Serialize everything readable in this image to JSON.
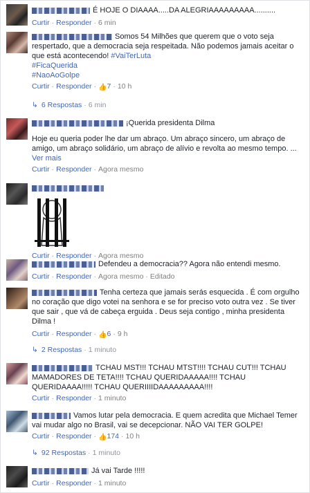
{
  "actions": {
    "curtir": "Curtir",
    "responder": "Responder",
    "edited": "Editado",
    "ver_mais": "Ver mais"
  },
  "comments": [
    {
      "text": "É HOJE O DIAAAA.....DA ALEGRIAAAAAAAAA..........",
      "time": "6 min"
    },
    {
      "text": "Somos 54 Milhões que querem que o voto seja respertado, que a democracia seja respeitada. Não podemos jamais aceitar o que está acontecendo!",
      "hashtag1": "#VaiTerLuta",
      "hashtag2": "#FicaQuerida",
      "hashtag3": "#NaoAoGolpe",
      "likes": "7",
      "time": "10 h",
      "replies": "6 Respostas",
      "replies_time": "6 min"
    },
    {
      "text_head": "¡Querida presidenta Dilma",
      "text": "Hoje eu queria poder lhe dar um abraço. Um abraço sincero, um abraço de amigo, um abraço solidário, um abraço de alívio e revolta ao mesmo tempo. ...",
      "time": "Agora mesmo"
    },
    {
      "time": "Agora mesmo"
    },
    {
      "text": "Defendeu a democracia?? Agora não entendi mesmo.",
      "time": "Agora mesmo"
    },
    {
      "text": "Tenha certeza que jamais serás esquecida . É com orgulho no coração que digo votei na senhora e se for preciso voto outra vez . Se tiver que sair , que vá de cabeça erguida . Deus seja contigo , minha presidenta Dilma !",
      "likes": "6",
      "time": "9 h",
      "replies": "2 Respostas",
      "replies_time": "1 minuto"
    },
    {
      "text": "TCHAU MST!!! TCHAU MTST!!!! TCHAU CUT!!! TCHAU MAMADORES DE TETA!!!! TCHAU QUERIDAAAAA!!!! TCHAU QUERIDAAAA!!!!! TCHAU QUERIIIIDAAAAAAAAA!!!!",
      "time": "1 minuto"
    },
    {
      "text": "Vamos lutar pela democracia. E quem acredita que Michael Temer vai mudar algo no Brasil, vai se decepcionar. NÃO VAI TER GOLPE!",
      "likes": "174",
      "time": "10 h",
      "replies": "92 Respostas",
      "replies_time": "1 minuto"
    },
    {
      "text": "Já vai Tarde !!!!!",
      "time": "1 minuto"
    }
  ],
  "colors": {
    "link": "#4267b2",
    "meta": "#90949c",
    "text": "#1d2129"
  }
}
